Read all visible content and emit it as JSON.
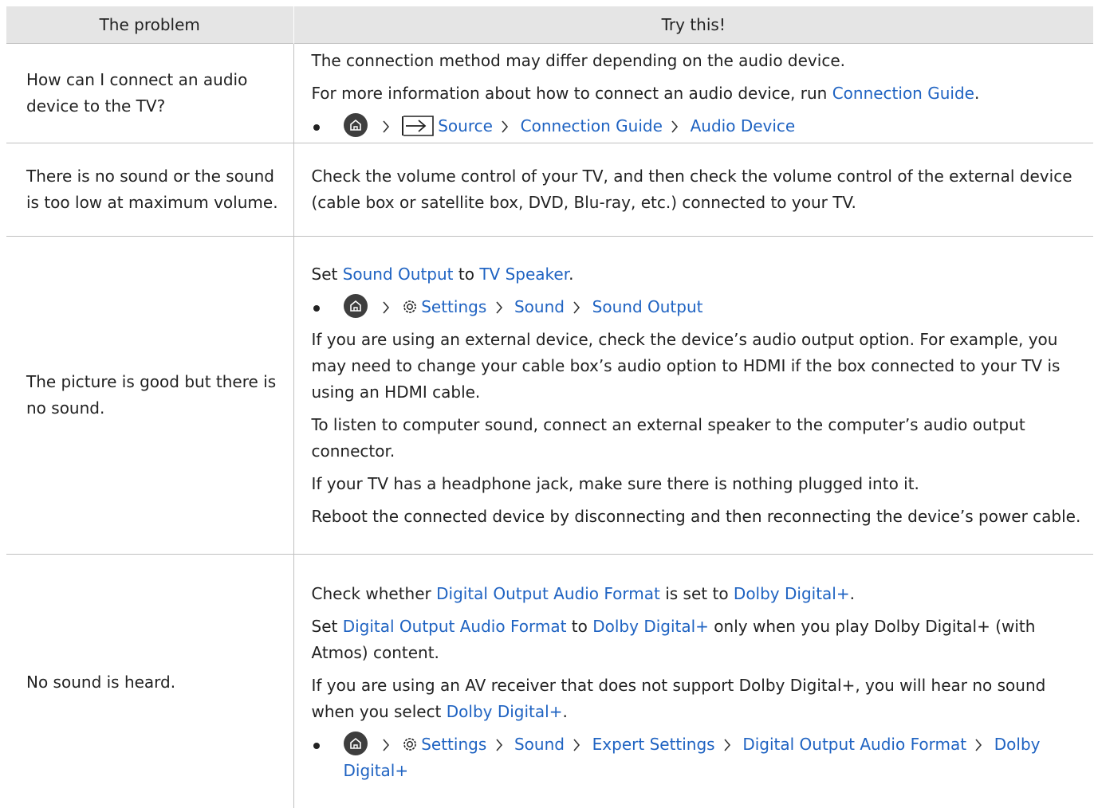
{
  "headers": {
    "problem": "The problem",
    "try": "Try this!"
  },
  "rows": [
    {
      "problem": "How can I connect an audio device to the TV?",
      "p1": "The connection method may differ depending on the audio device.",
      "p2_text": "For more information about how to connect an audio device, run ",
      "p2_link": "Connection Guide",
      "p2_end": ".",
      "path": [
        "Source",
        "Connection Guide",
        "Audio Device"
      ]
    },
    {
      "problem": "There is no sound or the sound is too low at maximum volume.",
      "p1": "Check the volume control of your TV, and then check the volume control of the external device (cable box or satellite box, DVD, Blu-ray, etc.) connected to your TV."
    },
    {
      "problem": "The picture is good but there is no sound.",
      "set_label": "Set ",
      "sound_output": "Sound Output",
      "to_label": " to ",
      "tv_speaker": "TV Speaker",
      "period": ".",
      "path": [
        "Settings",
        "Sound",
        "Sound Output"
      ],
      "p2": "If you are using an external device, check the device’s audio output option. For example, you may need to change your cable box’s audio option to HDMI if the box connected to your TV is using an HDMI cable.",
      "p3": "To listen to computer sound, connect an external speaker to the computer’s audio output connector.",
      "p4": "If your TV has a headphone jack, make sure there is nothing plugged into it.",
      "p5": "Reboot the connected device by disconnecting and then reconnecting the device’s power cable."
    },
    {
      "problem": "No sound is heard.",
      "check_label": "Check whether ",
      "digital_output": "Digital Output Audio Format",
      "is_set_to": " is set to ",
      "dolby": "Dolby Digital+",
      "period": ".",
      "set_label": "Set ",
      "to_label": " to ",
      "only_when": " only when you play Dolby Digital+ (with Atmos) content.",
      "p3_text": "If you are using an AV receiver that does not support Dolby Digital+, you will hear no sound when you select ",
      "path": [
        "Settings",
        "Sound",
        "Expert Settings",
        "Digital Output Audio Format",
        "Dolby Digital+"
      ]
    }
  ]
}
